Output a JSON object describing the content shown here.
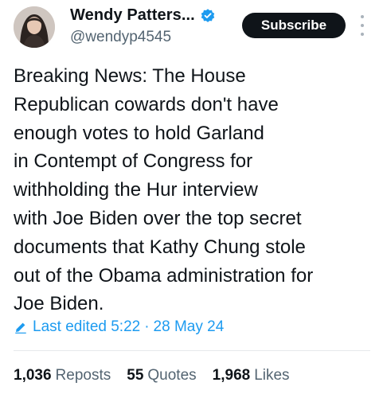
{
  "author": {
    "display_name": "Wendy Patters...",
    "handle": "@wendyp4545",
    "verified_icon": "verified-badge-icon",
    "avatar": "profile-photo"
  },
  "subscribe_label": "Subscribe",
  "tweet": {
    "lines": [
      "Breaking News:  The House",
      "Republican cowards don't have",
      "enough votes to hold Garland",
      "in Contempt of Congress for",
      "withholding the Hur interview",
      "with Joe Biden over the top secret",
      "documents that Kathy Chung stole",
      "out of the Obama administration for",
      "Joe Biden."
    ]
  },
  "edited": {
    "label": "Last edited 5:22",
    "separator": "·",
    "date": "28 May 24",
    "icon": "pencil-icon"
  },
  "stats": {
    "reposts_count": "1,036",
    "reposts_label": "Reposts",
    "quotes_count": "55",
    "quotes_label": "Quotes",
    "likes_count": "1,968",
    "likes_label": "Likes"
  },
  "colors": {
    "accent": "#1d9bf0",
    "text": "#0f1419",
    "muted": "#536471",
    "button_bg": "#0f1419"
  }
}
